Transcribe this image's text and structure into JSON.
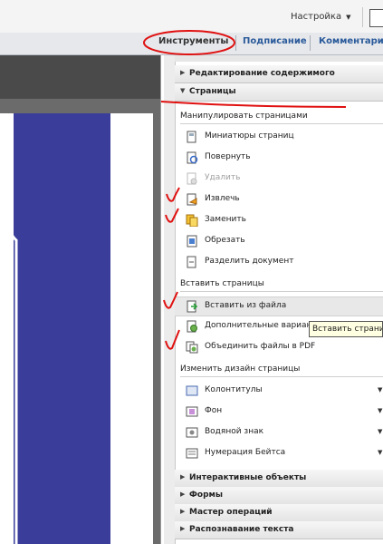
{
  "toolbar": {
    "settings_label": "Настройка"
  },
  "tabs": [
    {
      "label": "Инструменты"
    },
    {
      "label": "Подписание"
    },
    {
      "label": "Комментарии"
    }
  ],
  "panel": {
    "sections_top": [
      {
        "label": "Редактирование содержимого",
        "expanded": false
      },
      {
        "label": "Страницы",
        "expanded": true
      }
    ],
    "groups": [
      {
        "title": "Манипулировать страницами",
        "items": [
          {
            "label": "Миниатюры страниц",
            "icon": "thumbnails-icon",
            "enabled": true
          },
          {
            "label": "Повернуть",
            "icon": "rotate-icon",
            "enabled": true
          },
          {
            "label": "Удалить",
            "icon": "delete-icon",
            "enabled": false
          },
          {
            "label": "Извлечь",
            "icon": "extract-icon",
            "enabled": true
          },
          {
            "label": "Заменить",
            "icon": "replace-icon",
            "enabled": true
          },
          {
            "label": "Обрезать",
            "icon": "crop-icon",
            "enabled": true
          },
          {
            "label": "Разделить документ",
            "icon": "split-icon",
            "enabled": true
          }
        ]
      },
      {
        "title": "Вставить страницы",
        "items": [
          {
            "label": "Вставить из файла",
            "icon": "insert-from-file-icon",
            "enabled": true,
            "highlighted": true
          },
          {
            "label": "Дополнительные варианты в",
            "icon": "more-options-icon",
            "enabled": true
          },
          {
            "label": "Объединить файлы в PDF",
            "icon": "combine-icon",
            "enabled": true
          }
        ]
      },
      {
        "title": "Изменить дизайн страницы",
        "items": [
          {
            "label": "Колонтитулы",
            "icon": "header-footer-icon",
            "enabled": true,
            "dropdown": true
          },
          {
            "label": "Фон",
            "icon": "background-icon",
            "enabled": true,
            "dropdown": true
          },
          {
            "label": "Водяной знак",
            "icon": "watermark-icon",
            "enabled": true,
            "dropdown": true
          },
          {
            "label": "Нумерация Бейтса",
            "icon": "bates-icon",
            "enabled": true,
            "dropdown": true
          }
        ]
      }
    ],
    "sections_bottom": [
      {
        "label": "Интерактивные объекты"
      },
      {
        "label": "Формы"
      },
      {
        "label": "Мастер операций"
      },
      {
        "label": "Распознавание текста"
      }
    ],
    "tooltip": "Вставить страницу к"
  }
}
